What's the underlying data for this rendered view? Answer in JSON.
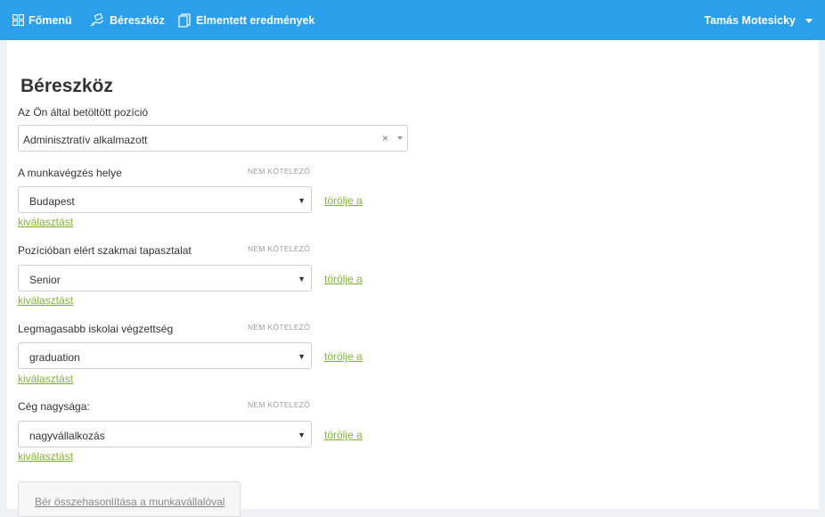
{
  "nav": {
    "home_label": "Főmenü",
    "tool_label": "Béreszköz",
    "saved_label": "Elmentett eredmények",
    "user_name": "Tamás Motesicky"
  },
  "page": {
    "title": "Béreszköz"
  },
  "position": {
    "label": "Az Ön által betöltött pozíció",
    "value": "Adminisztratív alkalmazott",
    "clear": "×"
  },
  "fields": [
    {
      "label": "A munkavégzés helye",
      "optional": "NEM KÖTELEZŐ",
      "value": "Budapest",
      "clear_a": "törölje a",
      "clear_b": "kiválasztást"
    },
    {
      "label": "Pozícióban elért szakmai tapasztalat",
      "optional": "NEM KÖTELEZŐ",
      "value": "Senior",
      "clear_a": "törölje a",
      "clear_b": "kiválasztást"
    },
    {
      "label": "Legmagasabb iskolai végzettség",
      "optional": "NEM KÖTELEZŐ",
      "value": "graduation",
      "clear_a": "törölje a",
      "clear_b": "kiválasztást"
    },
    {
      "label": "Cég nagysága:",
      "optional": "NEM KÖTELEZŐ",
      "value": "nagyvállalkozás",
      "clear_a": "törölje a",
      "clear_b": "kiválasztást"
    }
  ],
  "compare_button": "Bér összehasonlítása a munkavállalóval",
  "dropdown_arrow": "▼"
}
